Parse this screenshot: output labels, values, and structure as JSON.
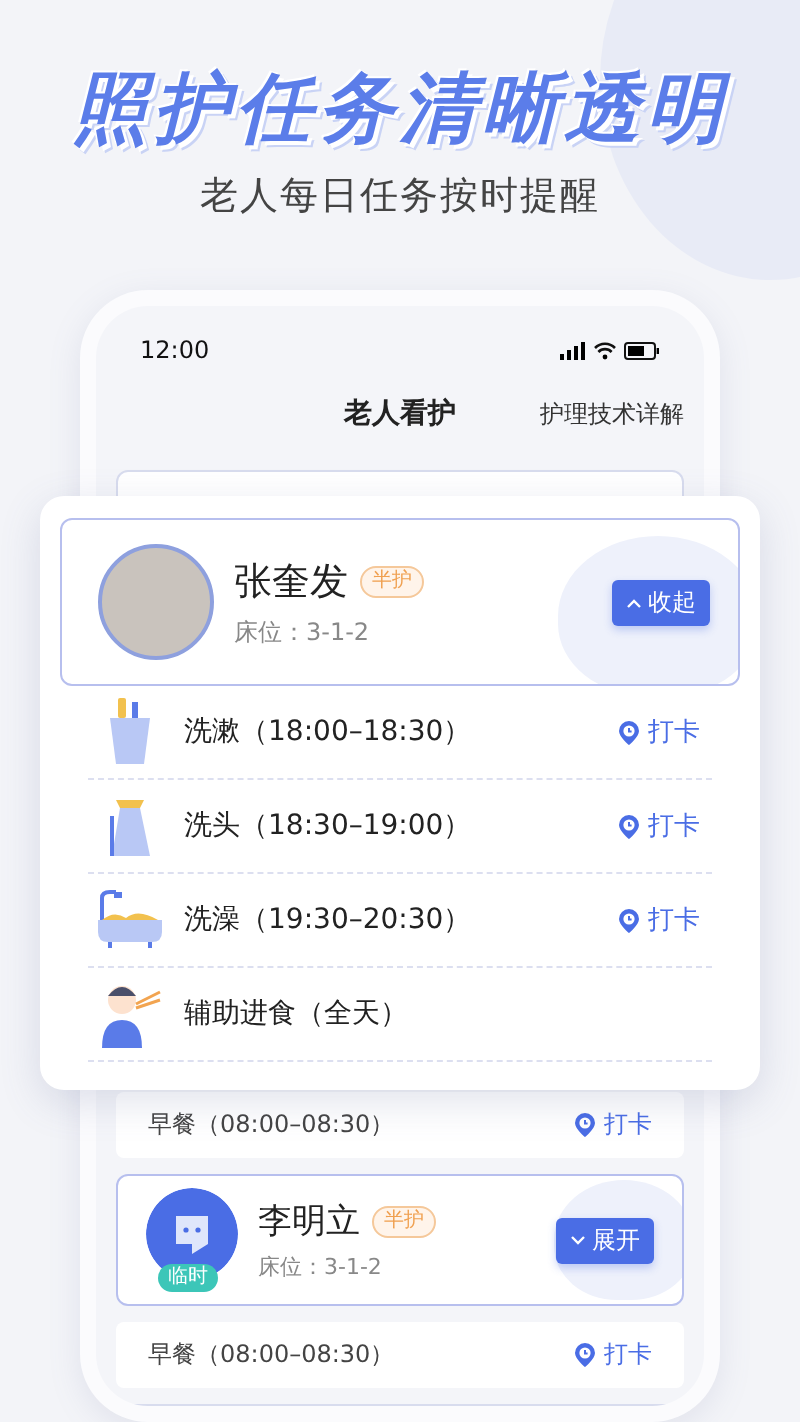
{
  "headline": "照护任务清晰透明",
  "subheadline": "老人每日任务按时提醒",
  "phone": {
    "status_bar": {
      "time": "12:00"
    },
    "nav": {
      "title": "老人看护",
      "action": "护理技术详解"
    },
    "expanded_card": {
      "name": "张奎发",
      "tag": "半护",
      "bed": "床位：3-1-2",
      "toggle": "收起",
      "expanded": true,
      "tasks": [
        {
          "kind": "wash",
          "label": "洗漱（18:00–18:30）",
          "action": "打卡"
        },
        {
          "kind": "hair",
          "label": "洗头（18:30–19:00）",
          "action": "打卡"
        },
        {
          "kind": "bath",
          "label": "洗澡（19:30–20:30）",
          "action": "打卡"
        },
        {
          "kind": "feeding",
          "label": "辅助进食（全天）"
        }
      ]
    },
    "list": [
      {
        "kind": "task",
        "label": "早餐（08:00–08:30）",
        "action": "打卡"
      },
      {
        "kind": "resident",
        "badge": "临时",
        "name": "李明立",
        "tag": "半护",
        "bed": "床位：3-1-2",
        "toggle": "展开",
        "expanded": false
      },
      {
        "kind": "task",
        "label": "早餐（08:00–08:30）",
        "action": "打卡"
      }
    ]
  }
}
